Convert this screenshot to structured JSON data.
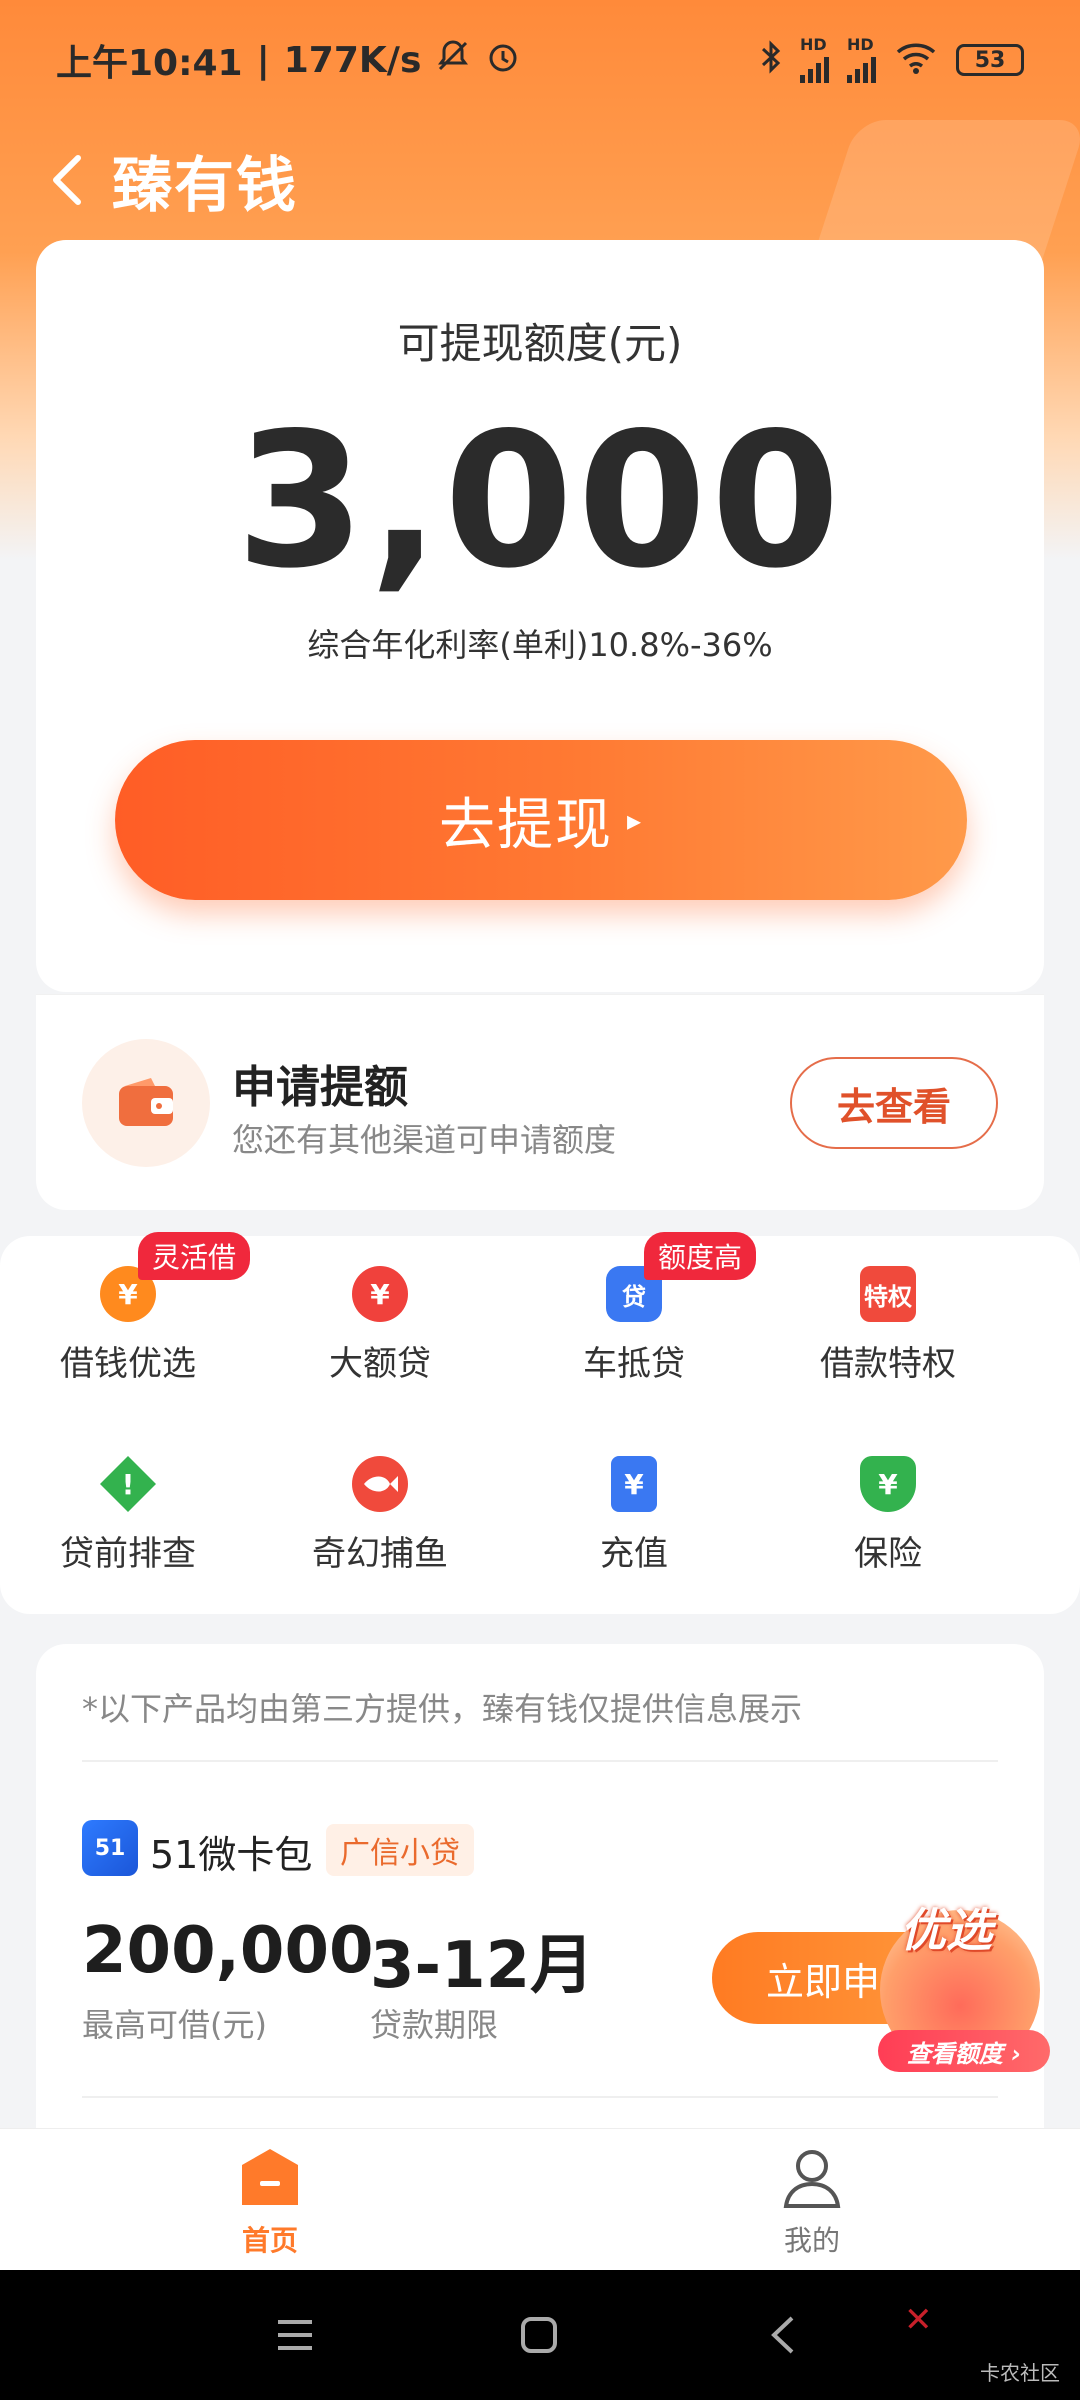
{
  "status_bar": {
    "time": "上午10:41",
    "speed": "177K/s",
    "battery": "53",
    "hd_label": "HD"
  },
  "header": {
    "title": "臻有钱"
  },
  "limit_card": {
    "label": "可提现额度(元)",
    "amount": "3,000",
    "rate": "综合年化利率(单利)10.8%-36%",
    "withdraw_button": "去提现",
    "arrow": "▸"
  },
  "apply_card": {
    "title": "申请提额",
    "subtitle": "您还有其他渠道可申请额度",
    "button": "去查看"
  },
  "services": [
    {
      "label": "借钱优选",
      "tag": "灵活借",
      "icon": "money-bag-icon",
      "color": "#ff8a1e",
      "glyph": "¥"
    },
    {
      "label": "大额贷",
      "tag": "",
      "icon": "money-bag-icon",
      "color": "#f0413c",
      "glyph": "¥"
    },
    {
      "label": "车抵贷",
      "tag": "额度高",
      "icon": "car-loan-icon",
      "color": "#3a78f2",
      "glyph": "贷"
    },
    {
      "label": "借款特权",
      "tag": "",
      "icon": "privilege-icon",
      "color": "#f04a3c",
      "glyph": "特权"
    },
    {
      "label": "贷前排查",
      "tag": "",
      "icon": "warning-icon",
      "color": "#33b24e",
      "glyph": "!"
    },
    {
      "label": "奇幻捕鱼",
      "tag": "",
      "icon": "fish-icon",
      "color": "#f04a3c",
      "glyph": ""
    },
    {
      "label": "充值",
      "tag": "",
      "icon": "recharge-icon",
      "color": "#3a78f2",
      "glyph": "¥"
    },
    {
      "label": "保险",
      "tag": "",
      "icon": "insurance-icon",
      "color": "#33b24e",
      "glyph": "¥"
    }
  ],
  "products": {
    "disclaimer": "*以下产品均由第三方提供，臻有钱仅提供信息展示",
    "item": {
      "logo_text": "51",
      "name": "51微卡包",
      "tag": "广信小贷",
      "amount": "200,000",
      "amount_label": "最高可借(元)",
      "term": "3-12月",
      "term_label": "贷款期限",
      "button": "立即申"
    },
    "badge": {
      "top": "优选",
      "bottom": "查看额度 ›"
    }
  },
  "bottom_nav": {
    "home": "首页",
    "mine": "我的"
  },
  "watermark": "卡农社区",
  "colors": {
    "accent": "#ff7a2a",
    "primary_button": "#ff6a2c",
    "tag_red": "#f0283c"
  }
}
